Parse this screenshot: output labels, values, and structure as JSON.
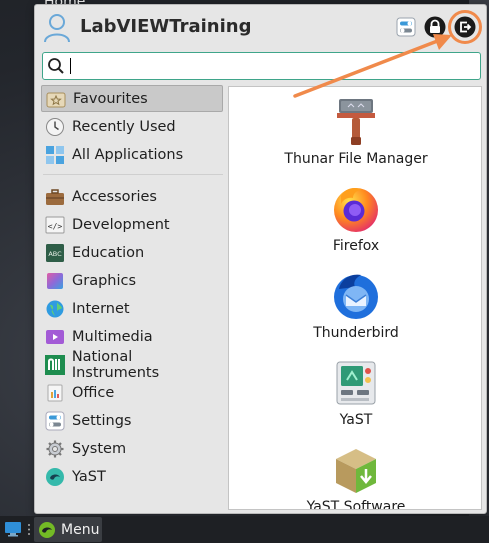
{
  "desktop": {
    "partial_label": "Home"
  },
  "header": {
    "username": "LabVIEWTraining"
  },
  "search": {
    "value": "",
    "placeholder": ""
  },
  "categories": [
    {
      "label": "Favourites",
      "icon": "star-folder-icon",
      "selected": true
    },
    {
      "label": "Recently Used",
      "icon": "clock-icon"
    },
    {
      "label": "All Applications",
      "icon": "grid-icon"
    },
    {
      "label": "Accessories",
      "icon": "briefcase-icon"
    },
    {
      "label": "Development",
      "icon": "code-icon"
    },
    {
      "label": "Education",
      "icon": "abc-icon"
    },
    {
      "label": "Graphics",
      "icon": "graphics-icon"
    },
    {
      "label": "Internet",
      "icon": "globe-icon"
    },
    {
      "label": "Multimedia",
      "icon": "multimedia-icon"
    },
    {
      "label": "National Instruments",
      "icon": "ni-logo-icon"
    },
    {
      "label": "Office",
      "icon": "office-icon"
    },
    {
      "label": "Settings",
      "icon": "settings-icon"
    },
    {
      "label": "System",
      "icon": "gear-icon"
    },
    {
      "label": "YaST",
      "icon": "yast-icon"
    }
  ],
  "apps": [
    {
      "label": "Thunar File Manager",
      "icon": "file-manager-icon"
    },
    {
      "label": "Firefox",
      "icon": "firefox-icon"
    },
    {
      "label": "Thunderbird",
      "icon": "thunderbird-icon"
    },
    {
      "label": "YaST",
      "icon": "yast-control-center-icon"
    },
    {
      "label": "YaST Software",
      "icon": "yast-software-icon"
    }
  ],
  "taskbar": {
    "menu_label": "Menu"
  },
  "colors": {
    "accent": "#3fa58a",
    "annotation": "#f08a4b",
    "selected_bg": "#c9c9c9",
    "menu_bg": "#e6e6e6"
  }
}
